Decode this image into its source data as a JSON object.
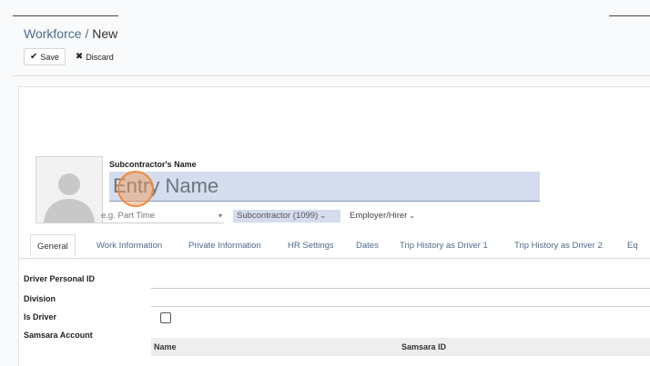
{
  "breadcrumb": {
    "parent": "Workforce",
    "separator": "/",
    "current": "New"
  },
  "toolbar": {
    "save_label": "Save",
    "save_icon": "✔",
    "discard_label": "Discard",
    "discard_icon": "✖"
  },
  "form": {
    "name_label": "Subcontractor's Name",
    "name_placeholder": "Entry Name",
    "employment_type_placeholder": "e.g. Part Time",
    "worker_type": "Subcontractor (1099)",
    "hirer": "Employer/Hirer"
  },
  "tabs": [
    {
      "label": "General",
      "active": true
    },
    {
      "label": "Work Information",
      "active": false
    },
    {
      "label": "Private Information",
      "active": false
    },
    {
      "label": "HR Settings",
      "active": false
    },
    {
      "label": "Dates",
      "active": false
    },
    {
      "label": "Trip History as Driver 1",
      "active": false
    },
    {
      "label": "Trip History as Driver 2",
      "active": false
    },
    {
      "label": "Eq",
      "active": false
    }
  ],
  "fields": {
    "driver_personal_id": "Driver Personal ID",
    "division": "Division",
    "is_driver": "Is Driver",
    "samsara_account": "Samsara Account"
  },
  "samsara_table": {
    "columns": [
      "Name",
      "Samsara ID"
    ]
  },
  "colors": {
    "accent": "#4e6a8e",
    "required_bg": "#d4dcee",
    "cursor": "#ef8a3c"
  }
}
